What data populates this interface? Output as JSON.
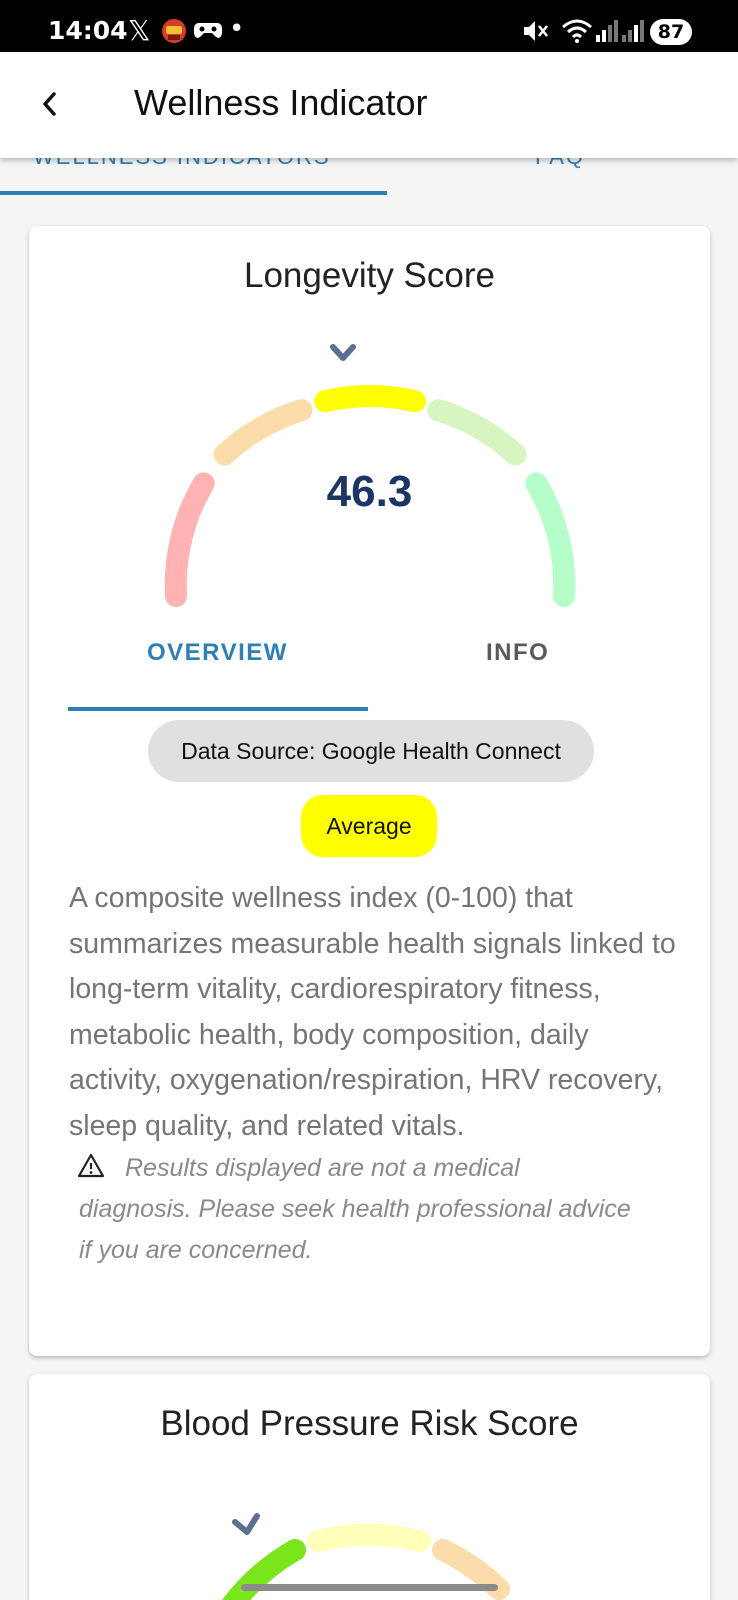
{
  "status_bar": {
    "time": "14:04",
    "x_glyph": "𝕏",
    "dot_glyph": "•",
    "battery": "87",
    "icons": [
      "x-app-icon",
      "avatar-icon",
      "game-controller-icon",
      "notification-dot-icon",
      "mute-icon",
      "wifi-icon",
      "signal-icon",
      "signal-icon",
      "battery-icon"
    ]
  },
  "header": {
    "title": "Wellness Indicator"
  },
  "main_tabs": {
    "tabs": [
      {
        "label": "WELLNESS INDICATORS",
        "selected": true
      },
      {
        "label": "FAQ",
        "selected": false
      }
    ]
  },
  "longevity_card": {
    "title": "Longevity Score",
    "value": "46.3",
    "tabs": [
      {
        "label": "OVERVIEW",
        "selected": true
      },
      {
        "label": "INFO",
        "selected": false
      }
    ],
    "data_source": "Data Source: Google Health Connect",
    "level": "Average",
    "description": "A composite wellness index (0-100) that summarizes measurable health signals linked to long-term vitality, cardiorespiratory fitness, metabolic health, body composition, daily activity, oxygenation/respiration, HRV recovery, sleep quality, and related vitals.",
    "disclaimer": "Results displayed are not a medical diagnosis. Please seek health professional advice if you are concerned.",
    "gauge_segments": [
      {
        "name": "very-low",
        "color": "#ffb3b3"
      },
      {
        "name": "low",
        "color": "#fddcab"
      },
      {
        "name": "average",
        "color": "#ffff00"
      },
      {
        "name": "good",
        "color": "#d6f5c0"
      },
      {
        "name": "very-good",
        "color": "#b5fdc9"
      }
    ],
    "active_segment": "average"
  },
  "blood_pressure_card": {
    "title": "Blood Pressure Risk Score",
    "gauge_segments": [
      {
        "name": "low-risk",
        "color": "#7be51b"
      },
      {
        "name": "moderate-risk",
        "color": "#feffb8"
      },
      {
        "name": "elevated-risk",
        "color": "#fddcab"
      }
    ],
    "active_segment": "low-risk"
  },
  "colors": {
    "accent_blue": "#2e7fb6",
    "value_navy": "#1d3466",
    "marker_slate": "#5c6f91",
    "average_yellow": "#ffff00",
    "chip_gray": "#e0e0e0"
  }
}
